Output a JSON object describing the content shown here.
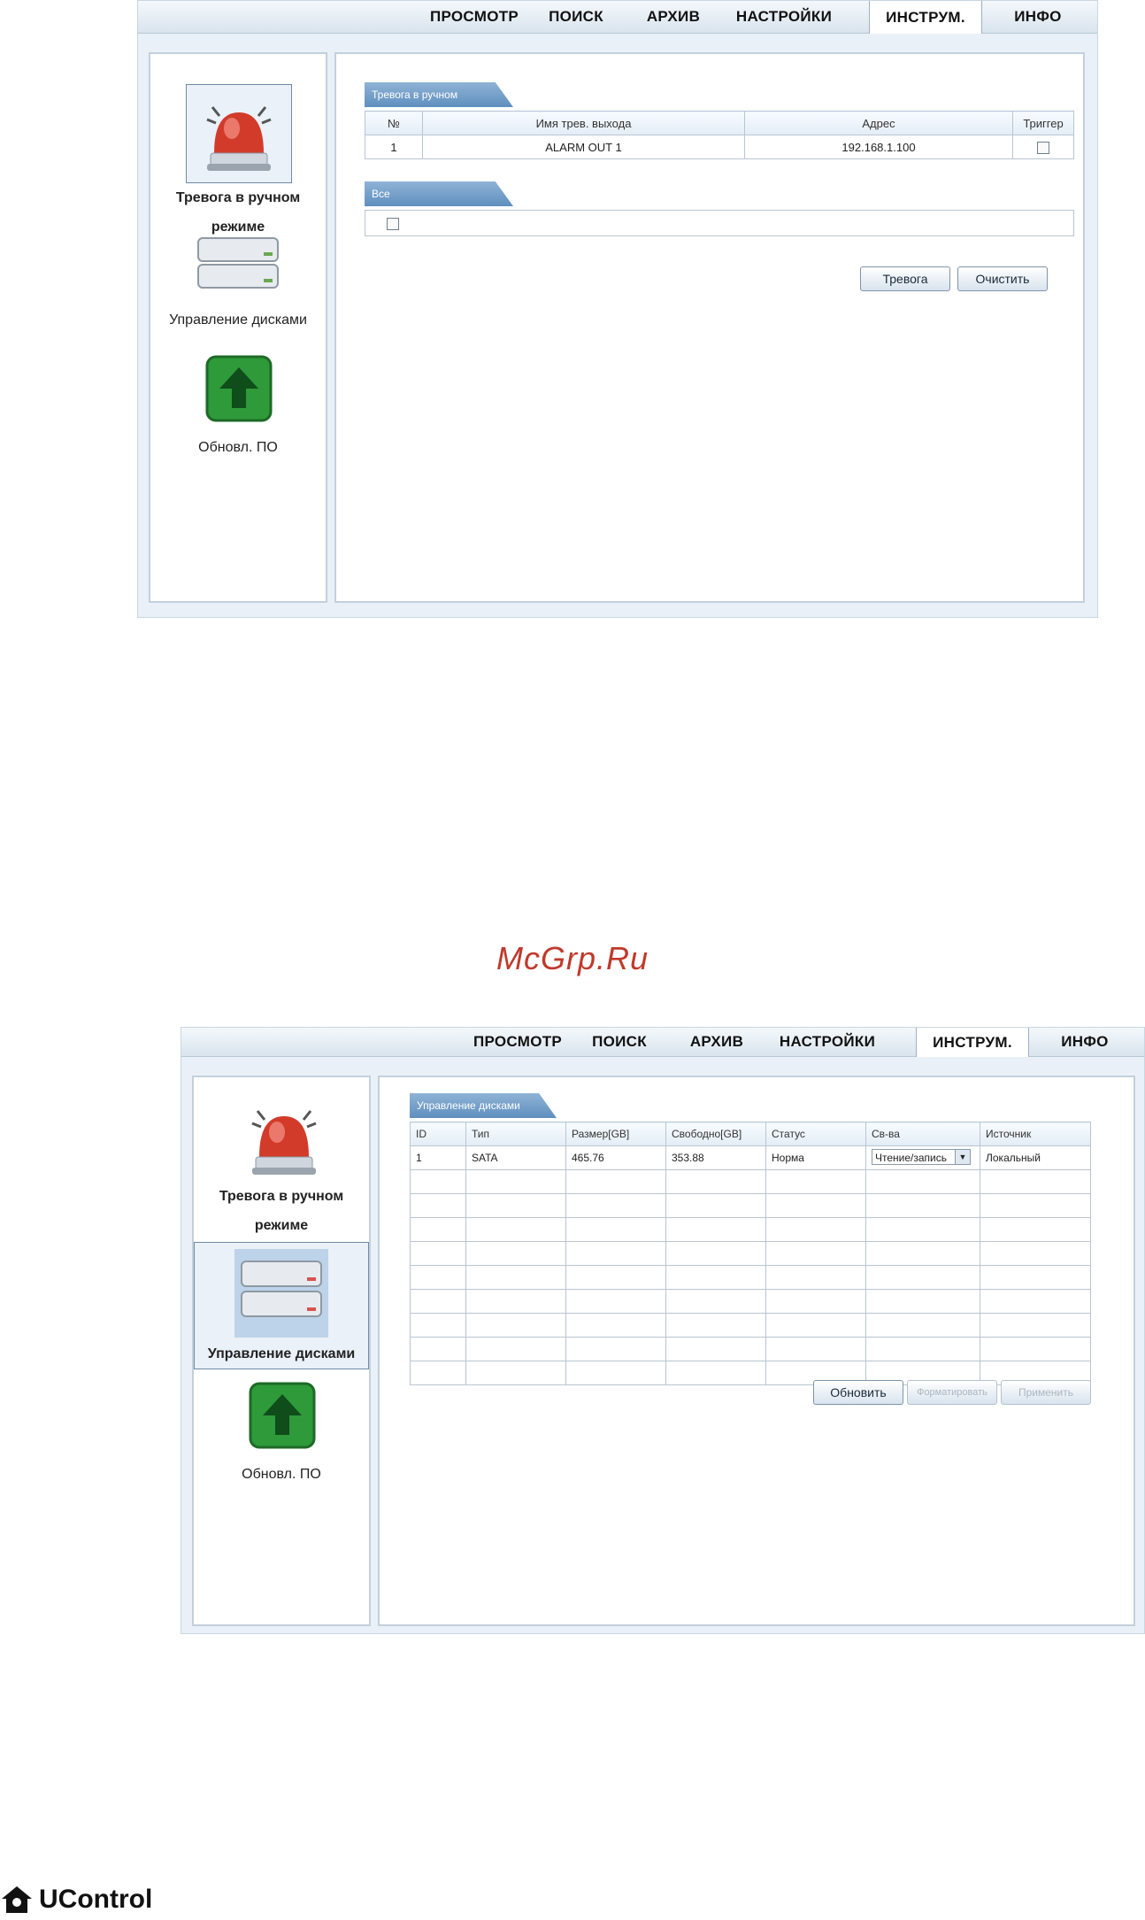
{
  "nav": {
    "tabs": [
      "ПРОСМОТР",
      "ПОИСК",
      "АРХИВ",
      "НАСТРОЙКИ",
      "ИНСТРУМ.",
      "ИНФО"
    ],
    "active": "ИНСТРУМ."
  },
  "tools": {
    "alarm": "Тревога в ручном режиме",
    "disk": "Управление дисками",
    "upgrade": "Обновл. ПО"
  },
  "screen1": {
    "section_title": "Тревога в ручном",
    "columns": [
      "№",
      "Имя трев. выхода",
      "Адрес",
      "Триггер"
    ],
    "row": {
      "no": "1",
      "name": "ALARM OUT 1",
      "address": "192.168.1.100"
    },
    "all_section_title": "Все",
    "buttons": {
      "alarm": "Тревога",
      "clear": "Очистить"
    }
  },
  "screen2": {
    "section_title": "Управление дисками",
    "columns": [
      "ID",
      "Тип",
      "Размер[GB]",
      "Свободно[GB]",
      "Статус",
      "Св-ва",
      "Источник"
    ],
    "row": {
      "id": "1",
      "type": "SATA",
      "size": "465.76",
      "free": "353.88",
      "status": "Норма",
      "property": "Чтение/запись",
      "source": "Локальный"
    },
    "buttons": {
      "refresh": "Обновить",
      "format": "Форматировать",
      "apply": "Применить"
    }
  },
  "watermark": "McGrp.Ru",
  "footer": {
    "brand": "UControl"
  },
  "colors": {
    "accent": "#5f8fbf",
    "alarm_red": "#d23b2a",
    "upgrade_green": "#2e9a3a"
  }
}
